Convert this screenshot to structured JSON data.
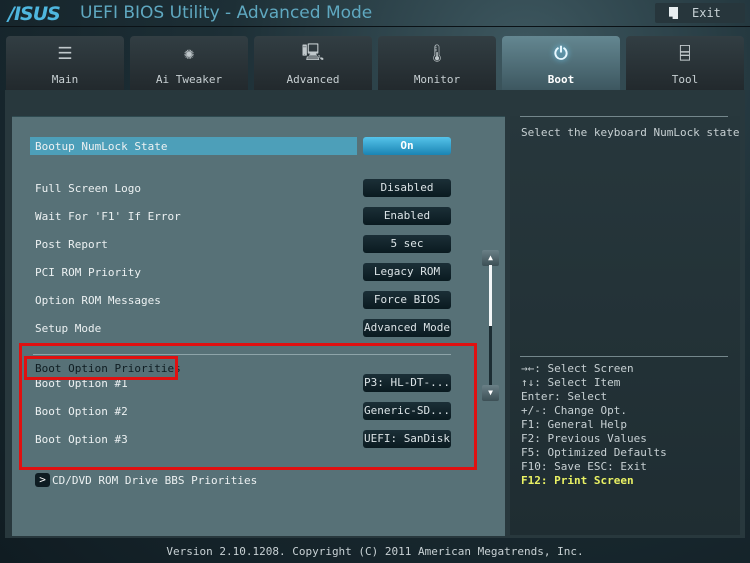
{
  "header": {
    "logo": "/ISUS",
    "title": "UEFI BIOS Utility - Advanced Mode",
    "exit_label": "Exit"
  },
  "tabs": [
    {
      "label": "Main",
      "icon": "list-icon",
      "glyph": "☰",
      "active": false
    },
    {
      "label": "Ai Tweaker",
      "icon": "cpu-fan-icon",
      "glyph": "✺",
      "active": false
    },
    {
      "label": "Advanced",
      "icon": "advanced-info-icon",
      "glyph": "🖳",
      "active": false
    },
    {
      "label": "Monitor",
      "icon": "thermometer-icon",
      "glyph": "🌡",
      "active": false
    },
    {
      "label": "Boot",
      "icon": "power-icon",
      "glyph": "⏻",
      "active": true
    },
    {
      "label": "Tool",
      "icon": "toolbox-icon",
      "glyph": "⌸",
      "active": false
    }
  ],
  "settings": [
    {
      "label": "Bootup NumLock State",
      "value": "On",
      "selected": true
    },
    {
      "label": "Full Screen Logo",
      "value": "Disabled"
    },
    {
      "label": "Wait For 'F1' If Error",
      "value": "Enabled"
    },
    {
      "label": "Post Report",
      "value": "5 sec"
    },
    {
      "label": "PCI ROM Priority",
      "value": "Legacy ROM"
    },
    {
      "label": "Option ROM Messages",
      "value": "Force BIOS"
    },
    {
      "label": "Setup Mode",
      "value": "Advanced Mode"
    }
  ],
  "boot_group": {
    "title": "Boot Option Priorities",
    "options": [
      {
        "label": "Boot Option #1",
        "value": "P3: HL-DT-..."
      },
      {
        "label": "Boot Option #2",
        "value": "Generic-SD..."
      },
      {
        "label": "Boot Option #3",
        "value": "UEFI: SanDisk"
      }
    ]
  },
  "submenu": {
    "arrow": ">",
    "label": "CD/DVD ROM Drive BBS Priorities"
  },
  "scrollbar": {
    "up": "▲",
    "down": "▼",
    "position_fraction": 0.0,
    "visible_fraction": 0.5
  },
  "help_text": "Select the keyboard NumLock state",
  "keys": [
    "→←: Select Screen",
    "↑↓: Select Item",
    "Enter: Select",
    "+/-: Change Opt.",
    "F1: General Help",
    "F2: Previous Values",
    "F5: Optimized Defaults",
    "F10: Save  ESC: Exit"
  ],
  "key_highlight": "F12: Print Screen",
  "footer": "Version 2.10.1208. Copyright (C) 2011 American Megatrends, Inc.",
  "colors": {
    "accent": "#4d9fb9",
    "highlight_key": "#eaf264",
    "annotation_red": "#e01010"
  }
}
